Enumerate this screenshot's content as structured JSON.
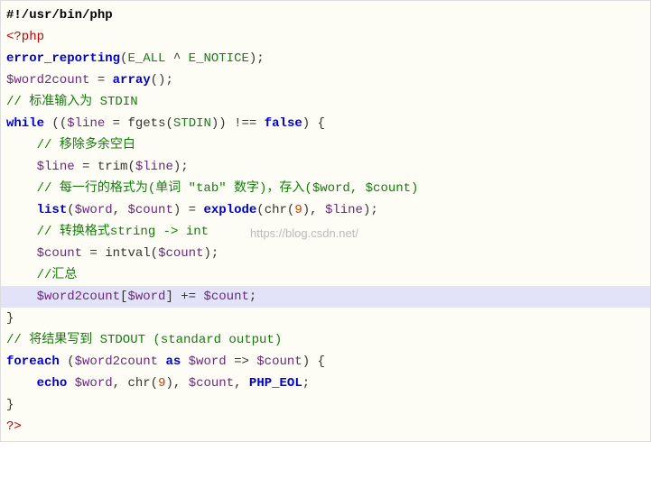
{
  "code": {
    "l1_shebang": "#!/usr/bin/php",
    "l2_open": "<?php",
    "l3_fn": "error_reporting",
    "l3_a": "E_ALL",
    "l3_op": " ^ ",
    "l3_b": "E_NOTICE",
    "l4_var": "$word2count",
    "l4_eq": " = ",
    "l4_fn": "array",
    "l5_cmt": "// 标准输入为 STDIN",
    "l6_while": "while",
    "l6_lp": " ((",
    "l6_var": "$line",
    "l6_eq": " = ",
    "l6_fgets": "fgets(",
    "l6_stdin": "STDIN",
    "l6_rp": ")) ",
    "l6_neq": "!== ",
    "l6_false": "false",
    "l6_end": ") {",
    "l7_cmt": "// 移除多余空白",
    "l8_var": "$line",
    "l8_eq": " = ",
    "l8_trim": "trim(",
    "l8_arg": "$line",
    "l8_end": ");",
    "l9_cmt": "// 每一行的格式为(单词 \"tab\" 数字)，存入($word, $count)",
    "l10_list": "list",
    "l10_lp": "(",
    "l10_w": "$word",
    "l10_c": ", ",
    "l10_cnt": "$count",
    "l10_rp": ") = ",
    "l10_explode": "explode",
    "l10_lp2": "(",
    "l10_chr": "chr(",
    "l10_nine": "9",
    "l10_rp2": "), ",
    "l10_line": "$line",
    "l10_end": ");",
    "l11_cmt": "// 转换格式string -> int",
    "l12_var": "$count",
    "l12_eq": " = ",
    "l12_intval": "intval(",
    "l12_arg": "$count",
    "l12_end": ");",
    "l13_cmt": "//汇总",
    "l14_arr": "$word2count",
    "l14_lb": "[",
    "l14_idx": "$word",
    "l14_rb": "]",
    "l14_op": " += ",
    "l14_val": "$count",
    "l14_end": ";",
    "l15_close": "}",
    "l16_cmt": "// 将结果写到 STDOUT (standard output)",
    "l17_foreach": "foreach",
    "l17_lp": " (",
    "l17_arr": "$word2count",
    "l17_as": " as ",
    "l17_w": "$word",
    "l17_arrow": " => ",
    "l17_c": "$count",
    "l17_end": ") {",
    "l18_echo": "echo",
    "l18_sp": " ",
    "l18_w": "$word",
    "l18_c1": ", ",
    "l18_chr": "chr(",
    "l18_nine": "9",
    "l18_rp": "), ",
    "l18_cnt": "$count",
    "l18_c2": ", ",
    "l18_eol": "PHP_EOL",
    "l18_end": ";",
    "l19_close": "}",
    "l20_close": "?>"
  },
  "watermark": "https://blog.csdn.net/",
  "indent1": "    ",
  "indent_hl": "    "
}
